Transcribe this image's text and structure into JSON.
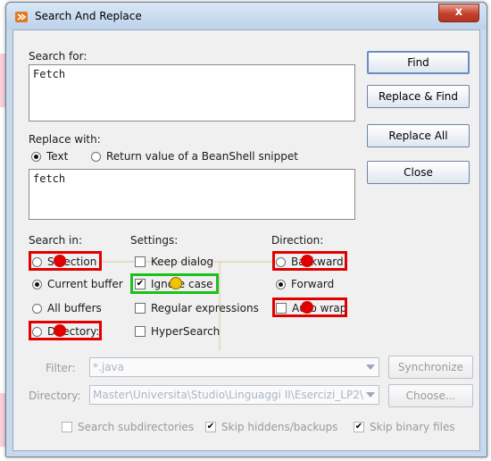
{
  "window": {
    "title": "Search And Replace",
    "close_glyph": "x"
  },
  "search": {
    "label": "Search for:",
    "value": "Fetch"
  },
  "replace": {
    "label": "Replace with:",
    "options": [
      {
        "label": "Text",
        "selected": true
      },
      {
        "label": "Return value of a BeanShell snippet",
        "selected": false
      }
    ],
    "value": "fetch"
  },
  "buttons": {
    "find": "Find",
    "replace_find": "Replace & Find",
    "replace_all": "Replace All",
    "close": "Close"
  },
  "search_in": {
    "label": "Search in:",
    "options": [
      {
        "label": "Selection",
        "selected": false
      },
      {
        "label": "Current buffer",
        "selected": true
      },
      {
        "label": "All buffers",
        "selected": false
      },
      {
        "label": "Directory:",
        "selected": false
      }
    ]
  },
  "settings": {
    "label": "Settings:",
    "options": [
      {
        "label": "Keep dialog",
        "checked": false
      },
      {
        "label": "Ignore case",
        "checked": true
      },
      {
        "label": "Regular expressions",
        "checked": false
      },
      {
        "label": "HyperSearch",
        "checked": false
      }
    ]
  },
  "direction": {
    "label": "Direction:",
    "options": [
      {
        "label": "Backward",
        "selected": false
      },
      {
        "label": "Forward",
        "selected": true
      }
    ],
    "auto_wrap": {
      "label": "Auto wrap",
      "checked": false
    }
  },
  "filter": {
    "label": "Filter:",
    "value": "*.java",
    "sync_button": "Synchronize"
  },
  "directory": {
    "label": "Directory:",
    "value": "Master\\Universita\\Studio\\Linguaggi II\\Esercizi_LP2\\",
    "choose_button": "Choose..."
  },
  "bottom_options": [
    {
      "label": "Search subdirectories",
      "checked": false
    },
    {
      "label": "Skip hiddens/backups",
      "checked": true
    },
    {
      "label": "Skip binary files",
      "checked": true
    }
  ],
  "colors": {
    "highlight_red": "#e00000",
    "highlight_green": "#1cc01c",
    "marker_yellow": "#f2c200"
  }
}
